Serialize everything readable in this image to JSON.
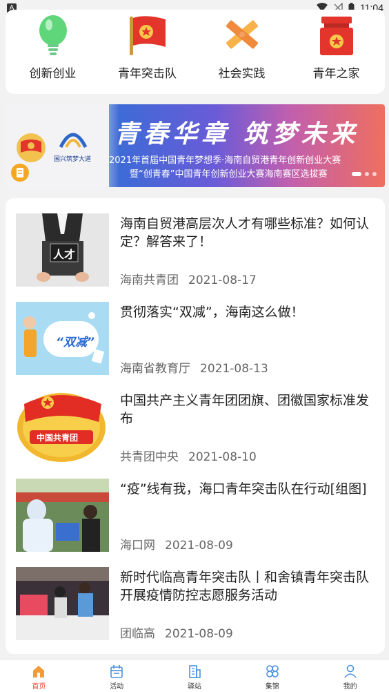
{
  "status_bar": {
    "time": "11:04",
    "left_badge": "A"
  },
  "categories": [
    {
      "label": "创新创业",
      "icon": "lightbulb-icon"
    },
    {
      "label": "青年突击队",
      "icon": "flag-icon"
    },
    {
      "label": "社会实践",
      "icon": "pencil-ruler-icon"
    },
    {
      "label": "青年之家",
      "icon": "home-building-icon"
    }
  ],
  "banner": {
    "title": "青春华章 筑梦未来",
    "line1": "2021年首届中国青年梦想季·海南自贸港青年创新创业大赛",
    "line2": "暨“创青春”中国青年创新创业大赛海南赛区选拔赛",
    "logo_text": "国兴筑梦大道"
  },
  "news": [
    {
      "title": "海南自贸港高层次人才有哪些标准？如何认定？解答来了！",
      "source": "海南共青团",
      "date": "2021-08-17",
      "thumb_text": "人才"
    },
    {
      "title": "贯彻落实“双减”，海南这么做！",
      "source": "海南省教育厅",
      "date": "2021-08-13",
      "thumb_text": "“双减”"
    },
    {
      "title": "中国共产主义青年团团旗、团徽国家标准发布",
      "source": "共青团中央",
      "date": "2021-08-10",
      "thumb_text": "中国共青团"
    },
    {
      "title": "“疫”线有我，海口青年突击队在行动[组图]",
      "source": "海口网",
      "date": "2021-08-09",
      "thumb_text": ""
    },
    {
      "title": "新时代临高青年突击队丨和舍镇青年突击队开展疫情防控志愿服务活动",
      "source": "团临高",
      "date": "2021-08-09",
      "thumb_text": ""
    }
  ],
  "bottom_nav": [
    {
      "label": "首页",
      "icon": "home-icon",
      "active": true
    },
    {
      "label": "活动",
      "icon": "calendar-icon",
      "active": false
    },
    {
      "label": "驿站",
      "icon": "building-icon",
      "active": false
    },
    {
      "label": "集锦",
      "icon": "clover-icon",
      "active": false
    },
    {
      "label": "我的",
      "icon": "user-icon",
      "active": false
    }
  ],
  "colors": {
    "accent": "#e8453c",
    "icon_blue": "#4a90e2",
    "background": "#f2f2f2"
  }
}
